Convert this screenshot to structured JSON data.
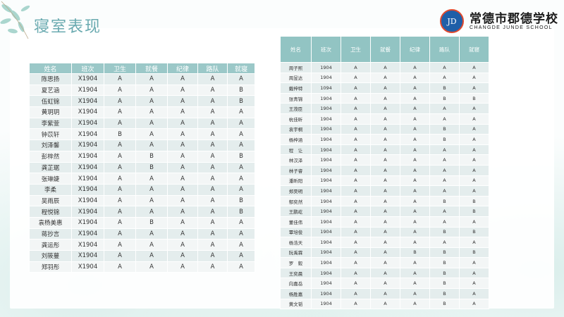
{
  "page": {
    "title": "寝室表现",
    "school_name": "常德市郡德学校",
    "school_name_en": "CHANGDE JUNDE SCHOOL",
    "logo_seal_text": "JD"
  },
  "table_left": {
    "headers": [
      "姓名",
      "班次",
      "卫生",
      "就餐",
      "纪律",
      "路队",
      "就寝"
    ],
    "rows": [
      [
        "陈思扬",
        "X1904",
        "A",
        "A",
        "A",
        "A",
        "A"
      ],
      [
        "夏艺涵",
        "X1904",
        "A",
        "A",
        "A",
        "A",
        "B"
      ],
      [
        "伍虹锦",
        "X1904",
        "A",
        "A",
        "A",
        "A",
        "B"
      ],
      [
        "黄玥玥",
        "X1904",
        "A",
        "A",
        "A",
        "A",
        "A"
      ],
      [
        "李紫萱",
        "X1904",
        "A",
        "A",
        "A",
        "A",
        "A"
      ],
      [
        "钟苡轩",
        "X1904",
        "B",
        "A",
        "A",
        "A",
        "A"
      ],
      [
        "刘泽馨",
        "X1904",
        "A",
        "A",
        "A",
        "A",
        "A"
      ],
      [
        "彭梓然",
        "X1904",
        "A",
        "B",
        "A",
        "A",
        "B"
      ],
      [
        "龚芷琚",
        "X1904",
        "A",
        "B",
        "A",
        "A",
        "A"
      ],
      [
        "张琳婕",
        "X1904",
        "A",
        "A",
        "A",
        "A",
        "A"
      ],
      [
        "李柔",
        "X1904",
        "A",
        "A",
        "A",
        "A",
        "A"
      ],
      [
        "吴雨辰",
        "X1904",
        "A",
        "A",
        "A",
        "A",
        "B"
      ],
      [
        "程悦锦",
        "X1904",
        "A",
        "A",
        "A",
        "A",
        "B"
      ],
      [
        "袁杨美惠",
        "X1904",
        "A",
        "B",
        "A",
        "A",
        "A"
      ],
      [
        "蒋抄言",
        "X1904",
        "A",
        "A",
        "A",
        "A",
        "A"
      ],
      [
        "龚运彤",
        "X1904",
        "A",
        "A",
        "A",
        "A",
        "A"
      ],
      [
        "刘筱蔓",
        "X1904",
        "A",
        "A",
        "A",
        "A",
        "A"
      ],
      [
        "郑羽彤",
        "X1904",
        "A",
        "A",
        "A",
        "A",
        "A"
      ]
    ]
  },
  "table_right": {
    "headers": [
      "姓名",
      "班次",
      "卫生",
      "就餐",
      "纪律",
      "路队",
      "就寝"
    ],
    "rows": [
      [
        "周子熙",
        "1904",
        "A",
        "A",
        "A",
        "A",
        "A"
      ],
      [
        "周昱达",
        "1904",
        "A",
        "A",
        "A",
        "A",
        "A"
      ],
      [
        "戴梓特",
        "1094",
        "A",
        "A",
        "A",
        "B",
        "A"
      ],
      [
        "张青锦",
        "1904",
        "A",
        "A",
        "A",
        "B",
        "B"
      ],
      [
        "王茂臣",
        "1904",
        "A",
        "A",
        "A",
        "A",
        "A"
      ],
      [
        "杭佳昕",
        "1904",
        "A",
        "A",
        "A",
        "A",
        "A"
      ],
      [
        "袁宇桐",
        "1904",
        "A",
        "A",
        "A",
        "B",
        "A"
      ],
      [
        "杨梓涵",
        "1904",
        "A",
        "A",
        "A",
        "B",
        "A"
      ],
      [
        "程　让",
        "1904",
        "A",
        "A",
        "A",
        "A",
        "A"
      ],
      [
        "林汉泽",
        "1904",
        "A",
        "A",
        "A",
        "A",
        "A"
      ],
      [
        "林子睿",
        "1904",
        "A",
        "A",
        "A",
        "A",
        "A"
      ],
      [
        "潘昕阳",
        "1904",
        "A",
        "A",
        "A",
        "A",
        "A"
      ],
      [
        "郑昊明",
        "1904",
        "A",
        "A",
        "A",
        "A",
        "A"
      ],
      [
        "郁奕然",
        "1904",
        "A",
        "A",
        "A",
        "B",
        "B"
      ],
      [
        "王鹏屹",
        "1904",
        "A",
        "A",
        "A",
        "A",
        "B"
      ],
      [
        "董佳伟",
        "1904",
        "A",
        "A",
        "A",
        "A",
        "A"
      ],
      [
        "覃培俊",
        "1904",
        "A",
        "A",
        "A",
        "B",
        "B"
      ],
      [
        "杨浩天",
        "1904",
        "A",
        "A",
        "A",
        "A",
        "A"
      ],
      [
        "阮禹霖",
        "1904",
        "A",
        "A",
        "B",
        "B",
        "B"
      ],
      [
        "罗　毅",
        "1904",
        "A",
        "A",
        "A",
        "B",
        "A"
      ],
      [
        "王奕晨",
        "1904",
        "A",
        "A",
        "A",
        "B",
        "A"
      ],
      [
        "向嘉岳",
        "1904",
        "A",
        "A",
        "A",
        "B",
        "A"
      ],
      [
        "杨胜嘉",
        "1904",
        "A",
        "A",
        "A",
        "B",
        "A"
      ],
      [
        "黄文韬",
        "1904",
        "A",
        "A",
        "A",
        "B",
        "A"
      ]
    ]
  }
}
